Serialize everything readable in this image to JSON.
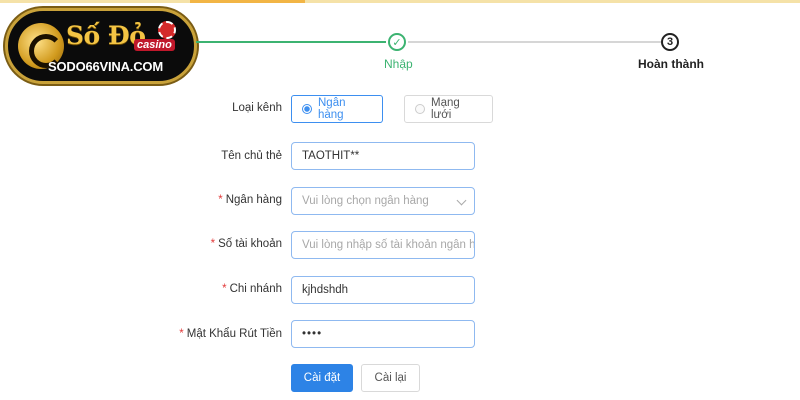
{
  "logo": {
    "title": "Số Đỏ",
    "badge": "casino",
    "url": "SODO66VINA.COM"
  },
  "steps": [
    {
      "number": "✓",
      "label": "Nhập",
      "status": "done"
    },
    {
      "number": "3",
      "label": "Hoàn thành",
      "status": "pending"
    }
  ],
  "form": {
    "channel": {
      "label": "Loại kênh",
      "options": [
        {
          "label": "Ngân hàng",
          "selected": true
        },
        {
          "label": "Mạng lưới",
          "selected": false
        }
      ]
    },
    "holder": {
      "label": "Tên chủ thẻ",
      "value": "TAOTHIT**"
    },
    "bank": {
      "label": "Ngân hàng",
      "placeholder": "Vui lòng chọn ngân hàng"
    },
    "account": {
      "label": "Số tài khoản",
      "placeholder": "Vui lòng nhập số tài khoản ngân hà"
    },
    "branch": {
      "label": "Chi nhánh",
      "value": "kjhdshdh"
    },
    "password": {
      "label": "Mật Khẩu Rút Tiền",
      "value": "••••"
    },
    "submit_label": "Cài đặt",
    "reset_label": "Cài lại"
  },
  "colors": {
    "accent": "#2d83e6",
    "success": "#3cb371",
    "required": "#e23a3a"
  }
}
